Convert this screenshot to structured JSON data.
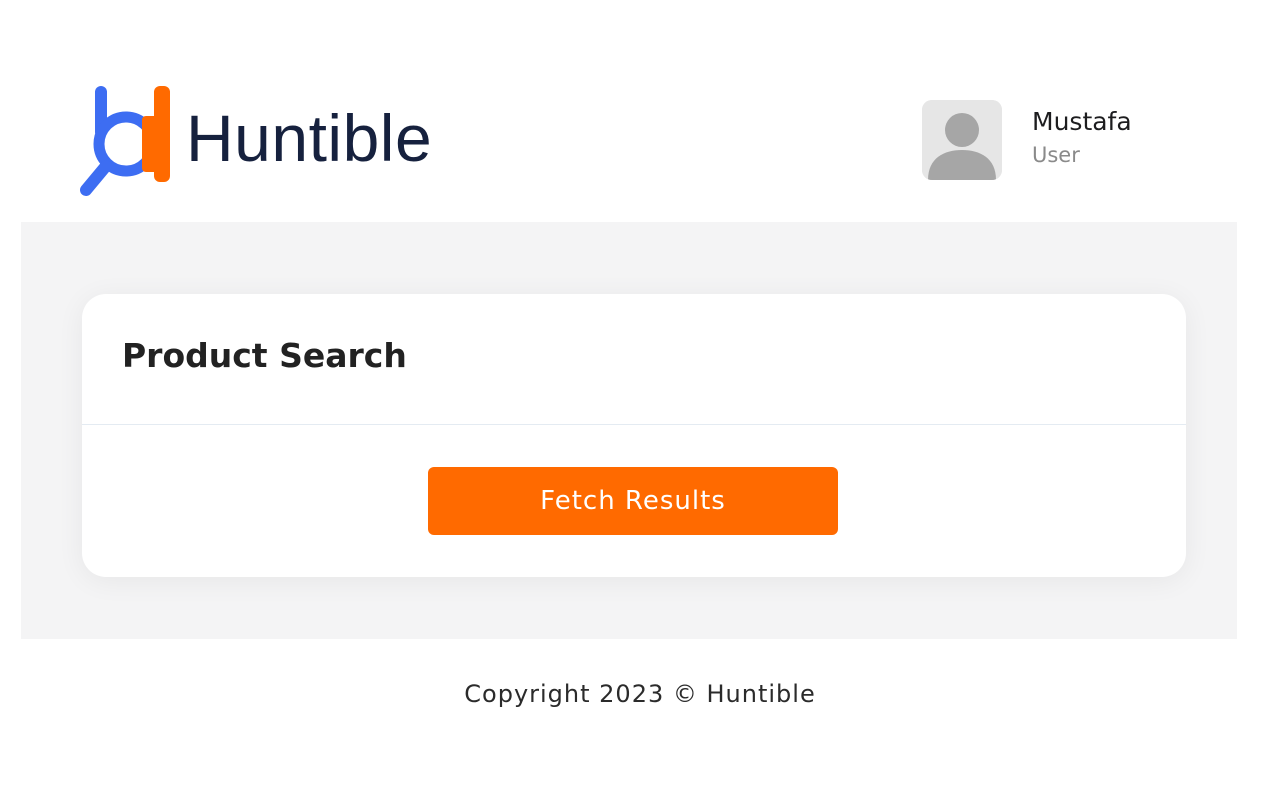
{
  "header": {
    "logo_text": "Huntible",
    "brand_colors": {
      "primary": "#ff6a00",
      "secondary": "#3d6df2",
      "text": "#16213e"
    },
    "user": {
      "name": "Mustafa",
      "role": "User",
      "avatar_icon": "user-avatar-icon"
    }
  },
  "main": {
    "card": {
      "title": "Product Search",
      "button_label": "Fetch Results",
      "button_color": "#ff6a00"
    }
  },
  "footer": {
    "copyright": "Copyright 2023 © Huntible"
  }
}
